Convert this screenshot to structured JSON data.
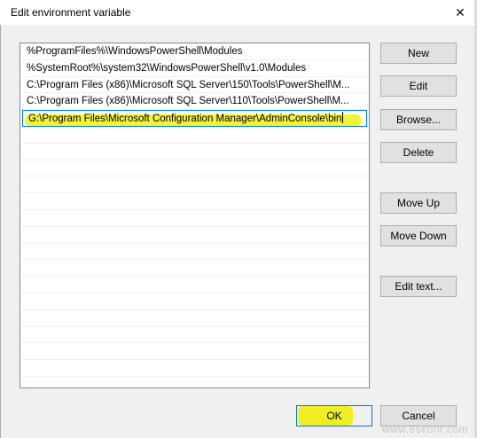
{
  "window": {
    "title": "Edit environment variable",
    "close_glyph": "✕"
  },
  "list": {
    "items": [
      {
        "label": "%ProgramFiles%\\WindowsPowerShell\\Modules"
      },
      {
        "label": "%SystemRoot%\\system32\\WindowsPowerShell\\v1.0\\Modules"
      },
      {
        "label": "C:\\Program Files (x86)\\Microsoft SQL Server\\150\\Tools\\PowerShell\\M..."
      },
      {
        "label": "C:\\Program Files (x86)\\Microsoft SQL Server\\110\\Tools\\PowerShell\\M..."
      },
      {
        "label": "G:\\Program Files\\Microsoft Configuration Manager\\AdminConsole\\bin"
      }
    ],
    "editing_index": 4,
    "highlight_color": "#f2f22a"
  },
  "buttons": {
    "new": "New",
    "edit": "Edit",
    "browse": "Browse...",
    "delete": "Delete",
    "move_up": "Move Up",
    "move_down": "Move Down",
    "edit_text": "Edit text...",
    "ok": "OK",
    "cancel": "Cancel"
  },
  "watermark": "www.eskonr.com"
}
